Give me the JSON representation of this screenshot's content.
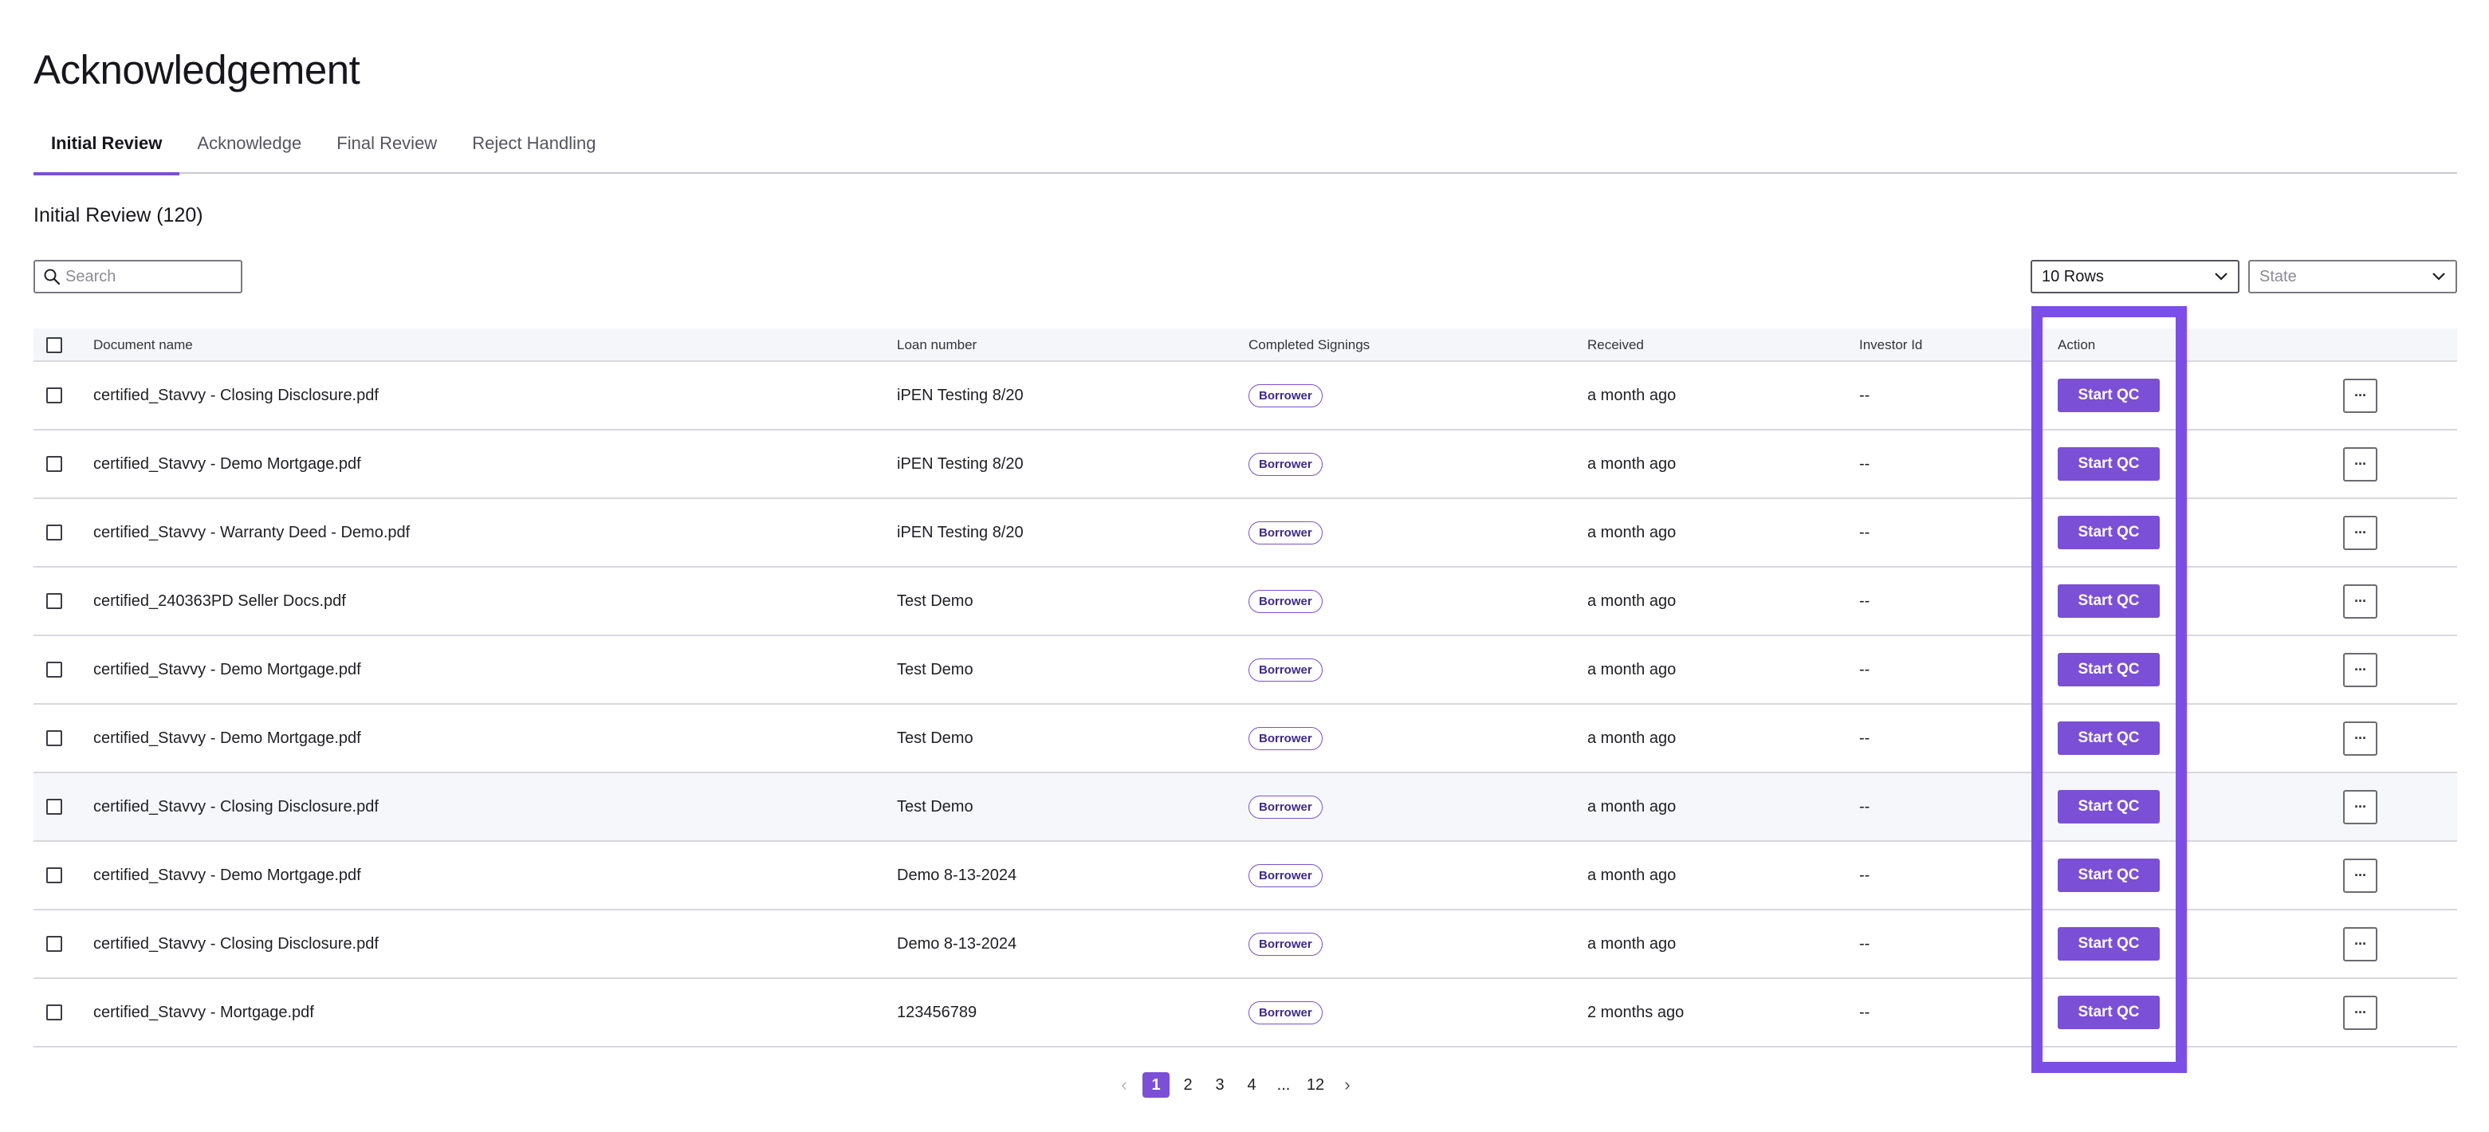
{
  "page_title": "Acknowledgement",
  "tabs": [
    {
      "label": "Initial Review",
      "active": true
    },
    {
      "label": "Acknowledge",
      "active": false
    },
    {
      "label": "Final Review",
      "active": false
    },
    {
      "label": "Reject Handling",
      "active": false
    }
  ],
  "section_title": "Initial Review (120)",
  "search": {
    "placeholder": "Search",
    "value": ""
  },
  "rows_select": {
    "value": "10 Rows"
  },
  "state_select": {
    "placeholder": "State"
  },
  "table": {
    "columns": [
      "Document name",
      "Loan number",
      "Completed Signings",
      "Received",
      "Investor Id",
      "Action"
    ],
    "rows": [
      {
        "document": "certified_Stavvy - Closing Disclosure.pdf",
        "loan": "iPEN Testing 8/20",
        "signing": "Borrower",
        "received": "a month ago",
        "investor": "--",
        "action": "Start QC"
      },
      {
        "document": "certified_Stavvy - Demo Mortgage.pdf",
        "loan": "iPEN Testing 8/20",
        "signing": "Borrower",
        "received": "a month ago",
        "investor": "--",
        "action": "Start QC"
      },
      {
        "document": "certified_Stavvy - Warranty Deed - Demo.pdf",
        "loan": "iPEN Testing 8/20",
        "signing": "Borrower",
        "received": "a month ago",
        "investor": "--",
        "action": "Start QC"
      },
      {
        "document": "certified_240363PD Seller Docs.pdf",
        "loan": "Test Demo",
        "signing": "Borrower",
        "received": "a month ago",
        "investor": "--",
        "action": "Start QC"
      },
      {
        "document": "certified_Stavvy - Demo Mortgage.pdf",
        "loan": "Test Demo",
        "signing": "Borrower",
        "received": "a month ago",
        "investor": "--",
        "action": "Start QC"
      },
      {
        "document": "certified_Stavvy - Demo Mortgage.pdf",
        "loan": "Test Demo",
        "signing": "Borrower",
        "received": "a month ago",
        "investor": "--",
        "action": "Start QC"
      },
      {
        "document": "certified_Stavvy - Closing Disclosure.pdf",
        "loan": "Test Demo",
        "signing": "Borrower",
        "received": "a month ago",
        "investor": "--",
        "action": "Start QC"
      },
      {
        "document": "certified_Stavvy - Demo Mortgage.pdf",
        "loan": "Demo 8-13-2024",
        "signing": "Borrower",
        "received": "a month ago",
        "investor": "--",
        "action": "Start QC"
      },
      {
        "document": "certified_Stavvy - Closing Disclosure.pdf",
        "loan": "Demo 8-13-2024",
        "signing": "Borrower",
        "received": "a month ago",
        "investor": "--",
        "action": "Start QC"
      },
      {
        "document": "certified_Stavvy - Mortgage.pdf",
        "loan": "123456789",
        "signing": "Borrower",
        "received": "2 months ago",
        "investor": "--",
        "action": "Start QC"
      }
    ],
    "more_label": "···"
  },
  "pagination": {
    "pages": [
      "1",
      "2",
      "3",
      "4"
    ],
    "ellipsis": "...",
    "last": "12",
    "current": "1"
  },
  "colors": {
    "accent": "#7b4fd6",
    "highlight": "#7b4fe6"
  }
}
